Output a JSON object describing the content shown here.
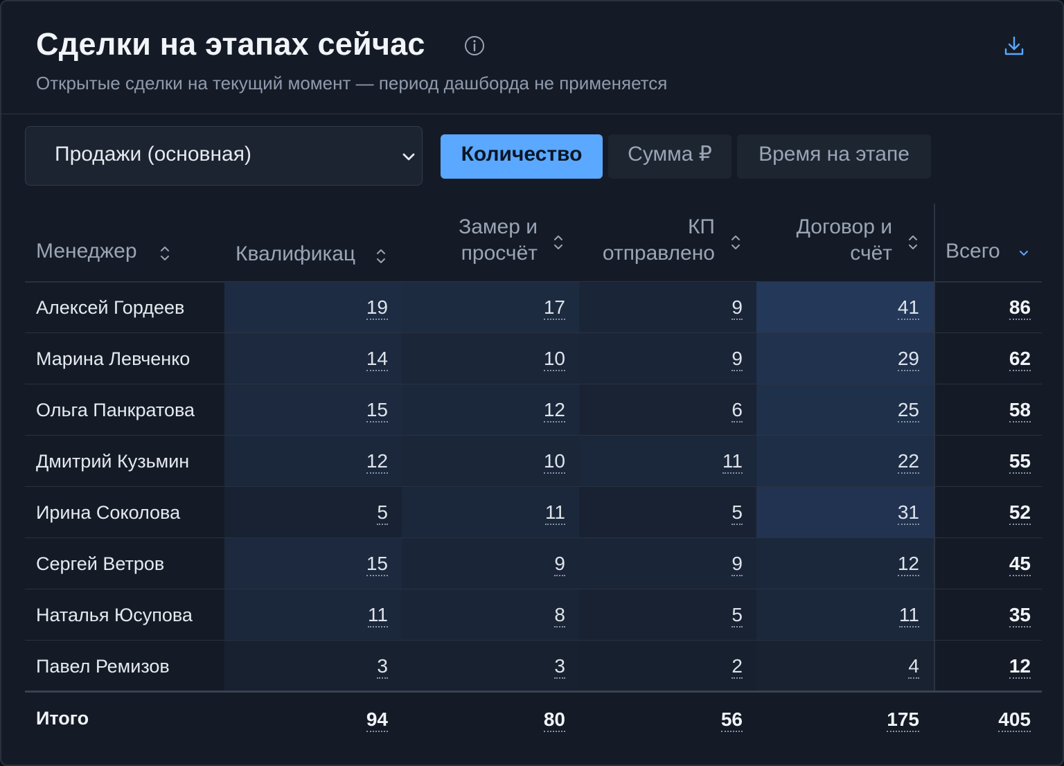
{
  "header": {
    "title": "Сделки на этапах сейчас",
    "subtitle": "Открытые сделки на текущий момент — период дашборда не применяется"
  },
  "controls": {
    "pipeline_select": "Продажи (основная)",
    "tabs": [
      {
        "label": "Количество",
        "active": true
      },
      {
        "label": "Сумма ₽",
        "active": false
      },
      {
        "label": "Время на этапе",
        "active": false
      }
    ]
  },
  "table": {
    "columns": [
      {
        "key": "manager",
        "label": "Менеджер",
        "sort": "none"
      },
      {
        "key": "qual",
        "label": "Квалификац",
        "sort": "none"
      },
      {
        "key": "measure",
        "label_line1": "Замер и",
        "label_line2": "просчёт",
        "sort": "none"
      },
      {
        "key": "kp",
        "label_line1": "КП",
        "label_line2": "отправлено",
        "sort": "none"
      },
      {
        "key": "contract",
        "label_line1": "Договор и",
        "label_line2": "счёт",
        "sort": "none"
      },
      {
        "key": "total",
        "label": "Всего",
        "sort": "desc"
      }
    ],
    "rows": [
      {
        "name": "Алексей Гордеев",
        "values": [
          19,
          17,
          9,
          41
        ],
        "total": 86
      },
      {
        "name": "Марина Левченко",
        "values": [
          14,
          10,
          9,
          29
        ],
        "total": 62
      },
      {
        "name": "Ольга Панкратова",
        "values": [
          15,
          12,
          6,
          25
        ],
        "total": 58
      },
      {
        "name": "Дмитрий Кузьмин",
        "values": [
          12,
          10,
          11,
          22
        ],
        "total": 55
      },
      {
        "name": "Ирина Соколова",
        "values": [
          5,
          11,
          5,
          31
        ],
        "total": 52
      },
      {
        "name": "Сергей Ветров",
        "values": [
          15,
          9,
          9,
          12
        ],
        "total": 45
      },
      {
        "name": "Наталья Юсупова",
        "values": [
          11,
          8,
          5,
          11
        ],
        "total": 35
      },
      {
        "name": "Павел Ремизов",
        "values": [
          3,
          3,
          2,
          4
        ],
        "total": 12
      }
    ],
    "totals": {
      "label": "Итого",
      "values": [
        94,
        80,
        56,
        175
      ],
      "total": 405
    }
  },
  "colors": {
    "accent": "#5aa8ff",
    "card_bg": "#151b26",
    "heat_base": "#151b26",
    "heat_max": "#24395a"
  },
  "icons": {
    "info": "info-circle-icon",
    "download": "download-icon",
    "select_chevron": "chevron-down-icon",
    "sort": "sort-updown-icon",
    "sort_desc": "sort-desc-icon"
  }
}
